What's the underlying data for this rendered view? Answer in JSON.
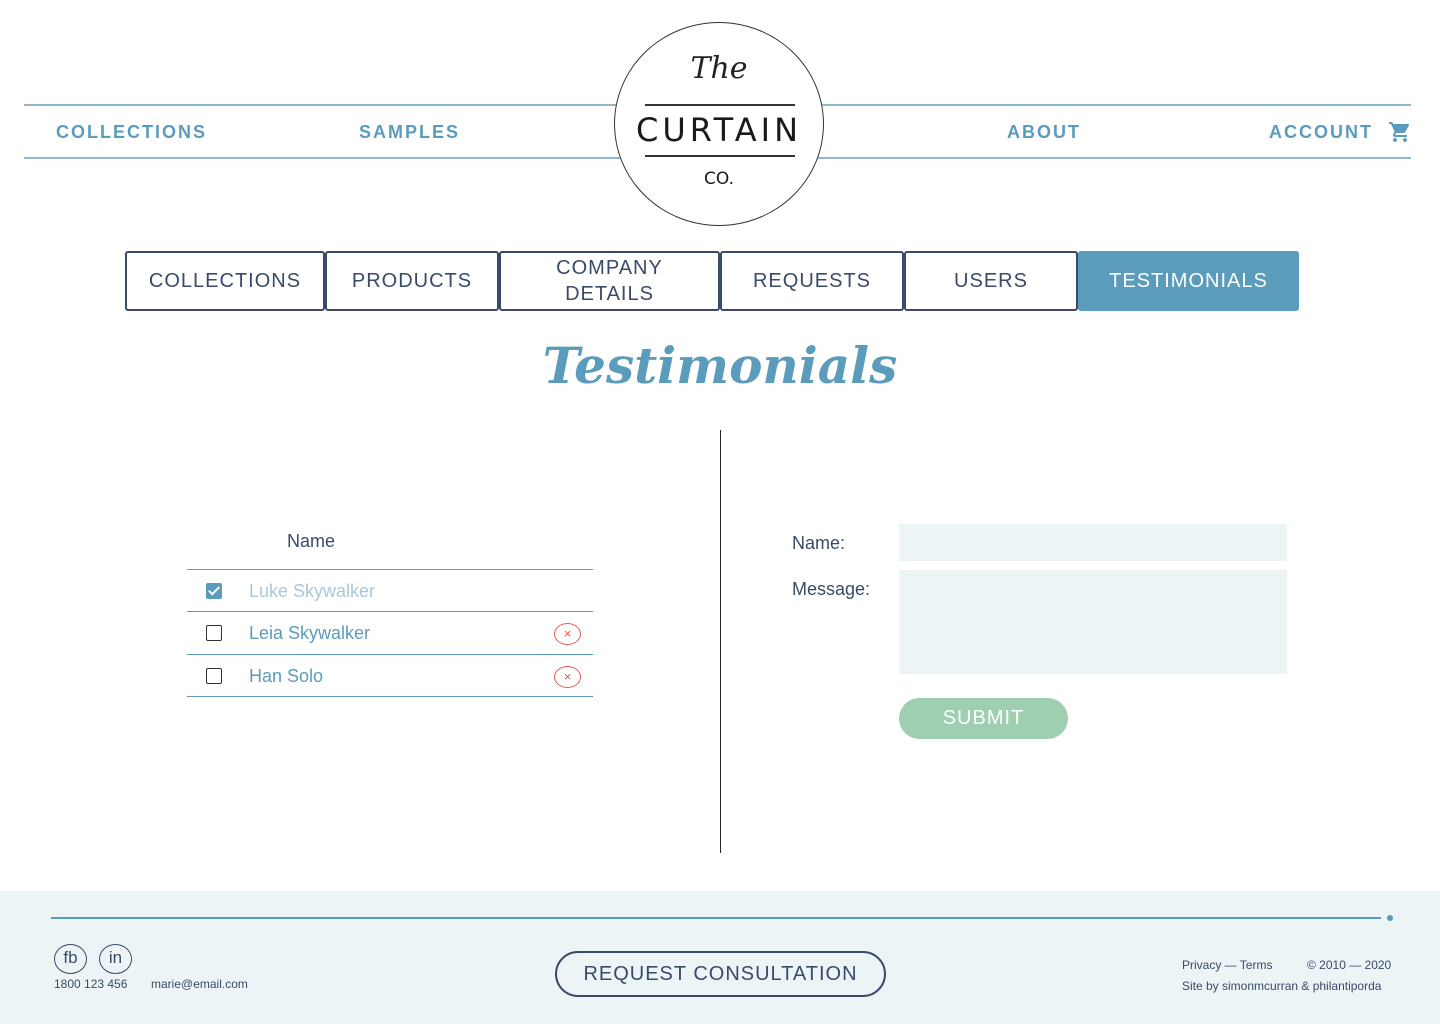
{
  "header": {
    "nav_left": [
      "COLLECTIONS",
      "SAMPLES"
    ],
    "nav_right": [
      "ABOUT",
      "ACCOUNT"
    ],
    "logo": {
      "the": "The",
      "main": "CURTAIN",
      "co": "CO."
    },
    "cart_icon": "cart-icon",
    "accent_color": "#5b9bbc"
  },
  "tabs": [
    {
      "label": "COLLECTIONS",
      "active": false
    },
    {
      "label": "PRODUCTS",
      "active": false
    },
    {
      "label": "COMPANY DETAILS",
      "active": false
    },
    {
      "label": "REQUESTS",
      "active": false
    },
    {
      "label": "USERS",
      "active": false
    },
    {
      "label": "TESTIMONIALS",
      "active": true
    }
  ],
  "page_title": "Testimonials",
  "list": {
    "header": "Name",
    "rows": [
      {
        "name": "Luke Skywalker",
        "checked": true,
        "deletable": false
      },
      {
        "name": "Leia Skywalker",
        "checked": false,
        "deletable": true
      },
      {
        "name": "Han Solo",
        "checked": false,
        "deletable": true
      }
    ],
    "delete_icon": "close-icon",
    "delete_color": "#e05a5a"
  },
  "form": {
    "name_label": "Name:",
    "name_value": "",
    "message_label": "Message:",
    "message_value": "",
    "submit_label": "SUBMIT",
    "submit_color": "#9dcfb0"
  },
  "footer": {
    "social": [
      "fb",
      "in"
    ],
    "phone": "1800 123 456",
    "email": "marie@email.com",
    "cta_label": "REQUEST CONSULTATION",
    "links": "Privacy — Terms",
    "copyright": "© 2010 — 2020",
    "credit": "Site by simonmcurran & philantiporda"
  }
}
